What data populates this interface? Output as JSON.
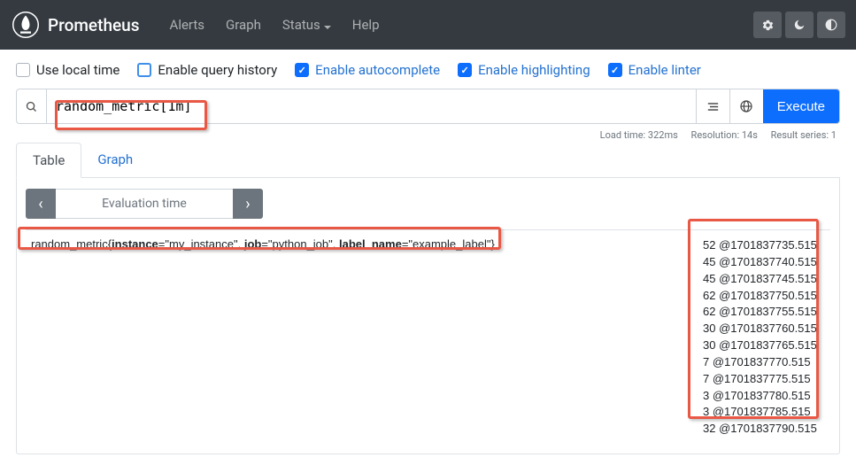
{
  "brand": {
    "title": "Prometheus"
  },
  "nav": {
    "alerts": "Alerts",
    "graph": "Graph",
    "status": "Status",
    "help": "Help"
  },
  "options": {
    "local_time": "Use local time",
    "query_history": "Enable query history",
    "autocomplete": "Enable autocomplete",
    "highlighting": "Enable highlighting",
    "linter": "Enable linter"
  },
  "query": {
    "value": "random_metric[1m]",
    "execute": "Execute"
  },
  "status": {
    "load": "Load time: 322ms",
    "resolution": "Resolution: 14s",
    "series": "Result series: 1"
  },
  "tabs": {
    "table": "Table",
    "graph": "Graph"
  },
  "eval": {
    "label": "Evaluation time"
  },
  "result": {
    "metric_name": "random_metric",
    "labels": [
      {
        "k": "instance",
        "v": "my_instance"
      },
      {
        "k": "job",
        "v": "python_job"
      },
      {
        "k": "label_name",
        "v": "example_label"
      }
    ],
    "samples": [
      "52 @1701837735.515",
      "45 @1701837740.515",
      "45 @1701837745.515",
      "62 @1701837750.515",
      "62 @1701837755.515",
      "30 @1701837760.515",
      "30 @1701837765.515",
      "7 @1701837770.515",
      "7 @1701837775.515",
      "3 @1701837780.515",
      "3 @1701837785.515",
      "32 @1701837790.515"
    ]
  }
}
